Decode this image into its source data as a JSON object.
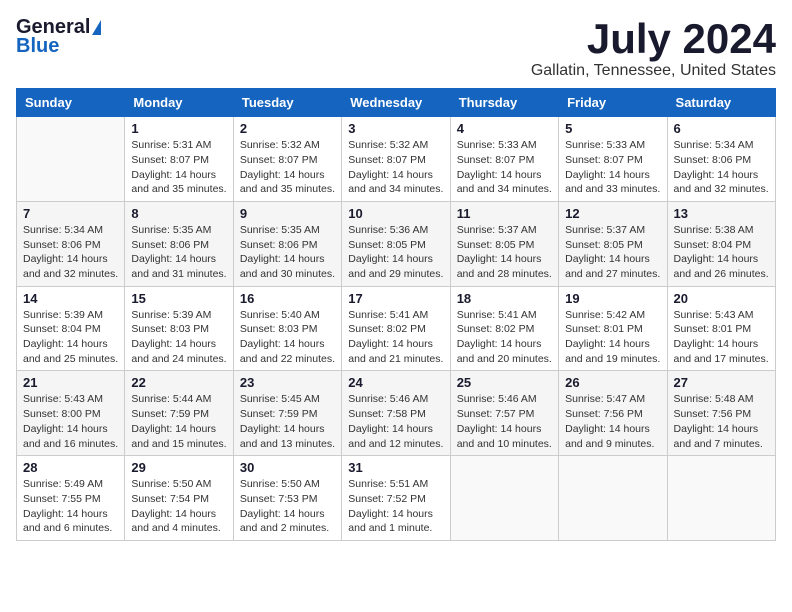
{
  "header": {
    "logo_general": "General",
    "logo_blue": "Blue",
    "title": "July 2024",
    "location": "Gallatin, Tennessee, United States"
  },
  "calendar": {
    "days_of_week": [
      "Sunday",
      "Monday",
      "Tuesday",
      "Wednesday",
      "Thursday",
      "Friday",
      "Saturday"
    ],
    "weeks": [
      [
        {
          "day": "",
          "sunrise": "",
          "sunset": "",
          "daylight": ""
        },
        {
          "day": "1",
          "sunrise": "Sunrise: 5:31 AM",
          "sunset": "Sunset: 8:07 PM",
          "daylight": "Daylight: 14 hours and 35 minutes."
        },
        {
          "day": "2",
          "sunrise": "Sunrise: 5:32 AM",
          "sunset": "Sunset: 8:07 PM",
          "daylight": "Daylight: 14 hours and 35 minutes."
        },
        {
          "day": "3",
          "sunrise": "Sunrise: 5:32 AM",
          "sunset": "Sunset: 8:07 PM",
          "daylight": "Daylight: 14 hours and 34 minutes."
        },
        {
          "day": "4",
          "sunrise": "Sunrise: 5:33 AM",
          "sunset": "Sunset: 8:07 PM",
          "daylight": "Daylight: 14 hours and 34 minutes."
        },
        {
          "day": "5",
          "sunrise": "Sunrise: 5:33 AM",
          "sunset": "Sunset: 8:07 PM",
          "daylight": "Daylight: 14 hours and 33 minutes."
        },
        {
          "day": "6",
          "sunrise": "Sunrise: 5:34 AM",
          "sunset": "Sunset: 8:06 PM",
          "daylight": "Daylight: 14 hours and 32 minutes."
        }
      ],
      [
        {
          "day": "7",
          "sunrise": "Sunrise: 5:34 AM",
          "sunset": "Sunset: 8:06 PM",
          "daylight": "Daylight: 14 hours and 32 minutes."
        },
        {
          "day": "8",
          "sunrise": "Sunrise: 5:35 AM",
          "sunset": "Sunset: 8:06 PM",
          "daylight": "Daylight: 14 hours and 31 minutes."
        },
        {
          "day": "9",
          "sunrise": "Sunrise: 5:35 AM",
          "sunset": "Sunset: 8:06 PM",
          "daylight": "Daylight: 14 hours and 30 minutes."
        },
        {
          "day": "10",
          "sunrise": "Sunrise: 5:36 AM",
          "sunset": "Sunset: 8:05 PM",
          "daylight": "Daylight: 14 hours and 29 minutes."
        },
        {
          "day": "11",
          "sunrise": "Sunrise: 5:37 AM",
          "sunset": "Sunset: 8:05 PM",
          "daylight": "Daylight: 14 hours and 28 minutes."
        },
        {
          "day": "12",
          "sunrise": "Sunrise: 5:37 AM",
          "sunset": "Sunset: 8:05 PM",
          "daylight": "Daylight: 14 hours and 27 minutes."
        },
        {
          "day": "13",
          "sunrise": "Sunrise: 5:38 AM",
          "sunset": "Sunset: 8:04 PM",
          "daylight": "Daylight: 14 hours and 26 minutes."
        }
      ],
      [
        {
          "day": "14",
          "sunrise": "Sunrise: 5:39 AM",
          "sunset": "Sunset: 8:04 PM",
          "daylight": "Daylight: 14 hours and 25 minutes."
        },
        {
          "day": "15",
          "sunrise": "Sunrise: 5:39 AM",
          "sunset": "Sunset: 8:03 PM",
          "daylight": "Daylight: 14 hours and 24 minutes."
        },
        {
          "day": "16",
          "sunrise": "Sunrise: 5:40 AM",
          "sunset": "Sunset: 8:03 PM",
          "daylight": "Daylight: 14 hours and 22 minutes."
        },
        {
          "day": "17",
          "sunrise": "Sunrise: 5:41 AM",
          "sunset": "Sunset: 8:02 PM",
          "daylight": "Daylight: 14 hours and 21 minutes."
        },
        {
          "day": "18",
          "sunrise": "Sunrise: 5:41 AM",
          "sunset": "Sunset: 8:02 PM",
          "daylight": "Daylight: 14 hours and 20 minutes."
        },
        {
          "day": "19",
          "sunrise": "Sunrise: 5:42 AM",
          "sunset": "Sunset: 8:01 PM",
          "daylight": "Daylight: 14 hours and 19 minutes."
        },
        {
          "day": "20",
          "sunrise": "Sunrise: 5:43 AM",
          "sunset": "Sunset: 8:01 PM",
          "daylight": "Daylight: 14 hours and 17 minutes."
        }
      ],
      [
        {
          "day": "21",
          "sunrise": "Sunrise: 5:43 AM",
          "sunset": "Sunset: 8:00 PM",
          "daylight": "Daylight: 14 hours and 16 minutes."
        },
        {
          "day": "22",
          "sunrise": "Sunrise: 5:44 AM",
          "sunset": "Sunset: 7:59 PM",
          "daylight": "Daylight: 14 hours and 15 minutes."
        },
        {
          "day": "23",
          "sunrise": "Sunrise: 5:45 AM",
          "sunset": "Sunset: 7:59 PM",
          "daylight": "Daylight: 14 hours and 13 minutes."
        },
        {
          "day": "24",
          "sunrise": "Sunrise: 5:46 AM",
          "sunset": "Sunset: 7:58 PM",
          "daylight": "Daylight: 14 hours and 12 minutes."
        },
        {
          "day": "25",
          "sunrise": "Sunrise: 5:46 AM",
          "sunset": "Sunset: 7:57 PM",
          "daylight": "Daylight: 14 hours and 10 minutes."
        },
        {
          "day": "26",
          "sunrise": "Sunrise: 5:47 AM",
          "sunset": "Sunset: 7:56 PM",
          "daylight": "Daylight: 14 hours and 9 minutes."
        },
        {
          "day": "27",
          "sunrise": "Sunrise: 5:48 AM",
          "sunset": "Sunset: 7:56 PM",
          "daylight": "Daylight: 14 hours and 7 minutes."
        }
      ],
      [
        {
          "day": "28",
          "sunrise": "Sunrise: 5:49 AM",
          "sunset": "Sunset: 7:55 PM",
          "daylight": "Daylight: 14 hours and 6 minutes."
        },
        {
          "day": "29",
          "sunrise": "Sunrise: 5:50 AM",
          "sunset": "Sunset: 7:54 PM",
          "daylight": "Daylight: 14 hours and 4 minutes."
        },
        {
          "day": "30",
          "sunrise": "Sunrise: 5:50 AM",
          "sunset": "Sunset: 7:53 PM",
          "daylight": "Daylight: 14 hours and 2 minutes."
        },
        {
          "day": "31",
          "sunrise": "Sunrise: 5:51 AM",
          "sunset": "Sunset: 7:52 PM",
          "daylight": "Daylight: 14 hours and 1 minute."
        },
        {
          "day": "",
          "sunrise": "",
          "sunset": "",
          "daylight": ""
        },
        {
          "day": "",
          "sunrise": "",
          "sunset": "",
          "daylight": ""
        },
        {
          "day": "",
          "sunrise": "",
          "sunset": "",
          "daylight": ""
        }
      ]
    ]
  }
}
